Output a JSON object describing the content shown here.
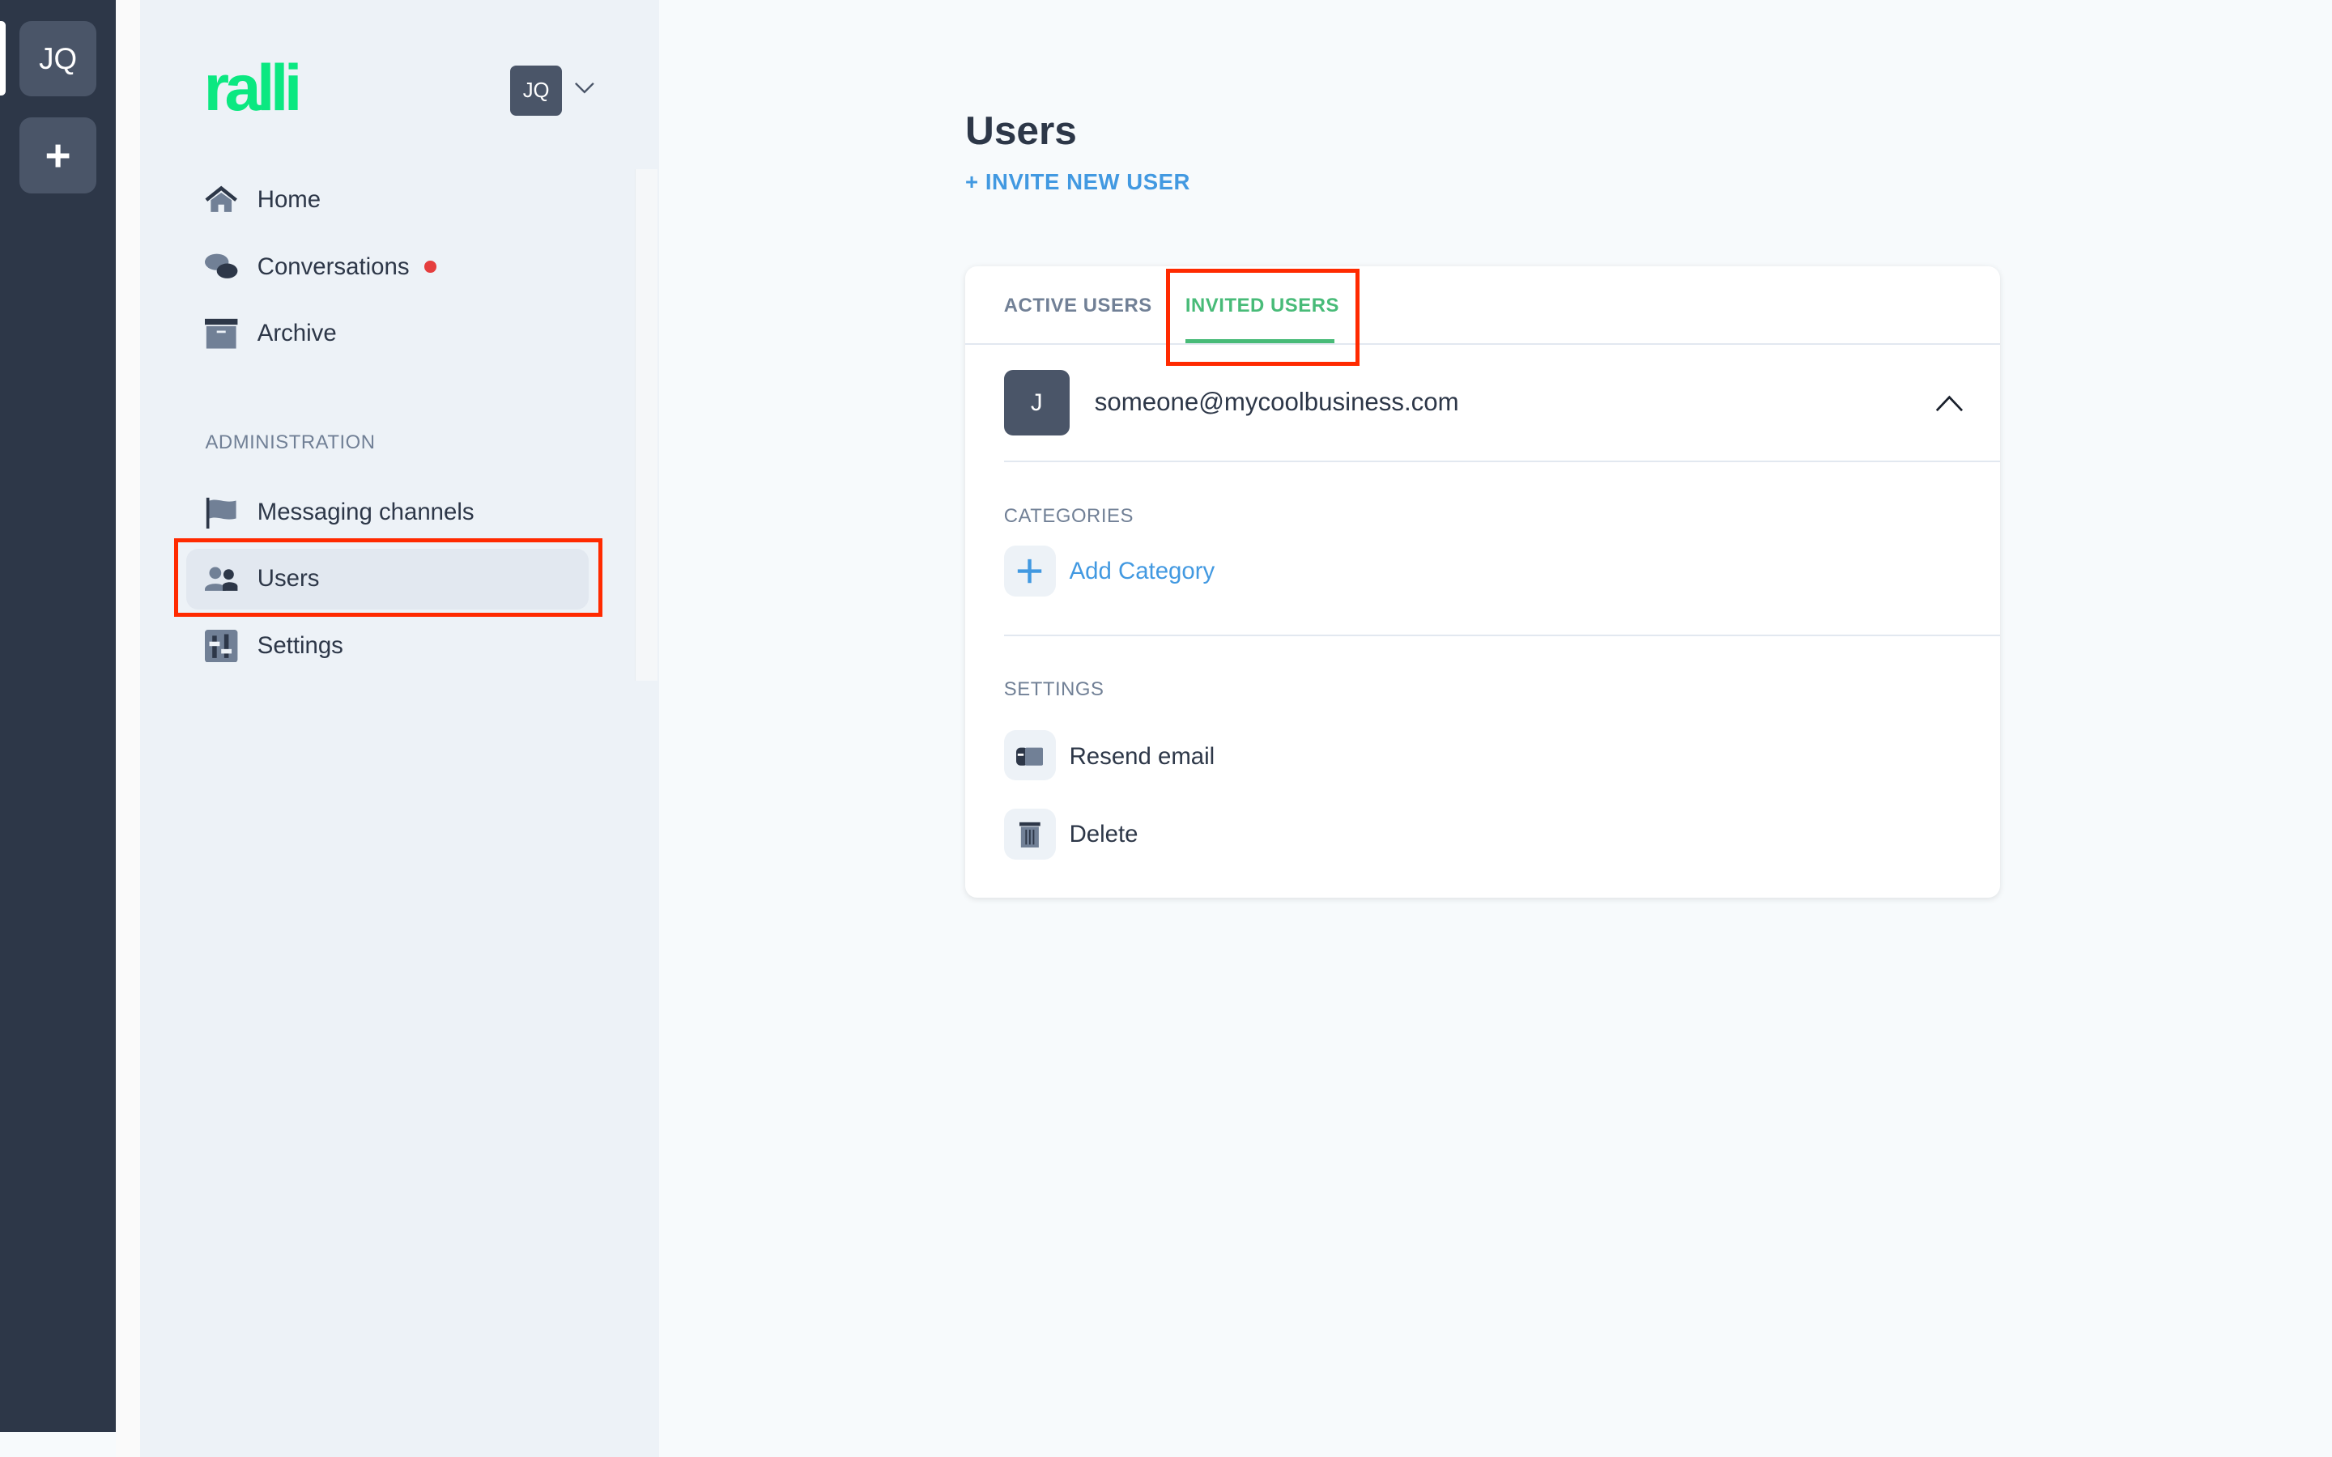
{
  "rail": {
    "workspace_initials": "JQ",
    "add_label": "+"
  },
  "sidebar": {
    "logo": "ralli",
    "user_initials": "JQ",
    "items": [
      {
        "label": "Home",
        "icon": "home-icon"
      },
      {
        "label": "Conversations",
        "icon": "chat-icon",
        "unread": true
      },
      {
        "label": "Archive",
        "icon": "archive-icon"
      }
    ],
    "admin_heading": "ADMINISTRATION",
    "admin_items": [
      {
        "label": "Messaging channels",
        "icon": "flag-icon"
      },
      {
        "label": "Users",
        "icon": "users-icon",
        "active": true
      },
      {
        "label": "Settings",
        "icon": "sliders-icon"
      }
    ]
  },
  "main": {
    "title": "Users",
    "invite_label": "+ INVITE NEW USER",
    "tabs": [
      {
        "label": "ACTIVE USERS"
      },
      {
        "label": "INVITED USERS",
        "active": true
      }
    ],
    "user": {
      "initial": "J",
      "email": "someone@mycoolbusiness.com",
      "expanded": true
    },
    "categories_heading": "CATEGORIES",
    "add_category_label": "Add Category",
    "settings_heading": "SETTINGS",
    "actions": [
      {
        "label": "Resend email",
        "icon": "mailbox-icon"
      },
      {
        "label": "Delete",
        "icon": "trash-icon"
      }
    ]
  },
  "colors": {
    "brand": "#0be881",
    "accent": "#4299e1",
    "tab_active": "#48bb78",
    "highlight": "#ff2a00",
    "rail": "#2d3748",
    "notification": "#e53e3e"
  }
}
